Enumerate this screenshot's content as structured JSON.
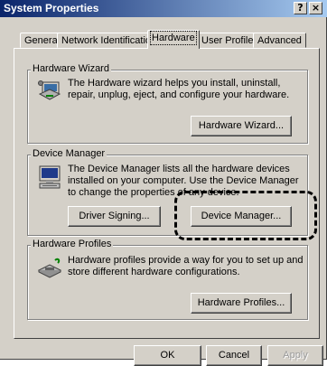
{
  "window": {
    "title": "System Properties"
  },
  "titlebar_buttons": {
    "help": "?",
    "close": "×"
  },
  "tabs": [
    {
      "label": "General"
    },
    {
      "label": "Network Identification"
    },
    {
      "label": "Hardware"
    },
    {
      "label": "User Profiles"
    },
    {
      "label": "Advanced"
    }
  ],
  "hardware_wizard": {
    "title": "Hardware Wizard",
    "description": "The Hardware wizard helps you install, uninstall, repair, unplug, eject, and configure your hardware.",
    "button": "Hardware Wizard..."
  },
  "device_manager": {
    "title": "Device Manager",
    "description": "The Device Manager lists all the hardware devices installed on your computer. Use the Device Manager to change the properties of any device.",
    "driver_signing_button": "Driver Signing...",
    "device_manager_button": "Device Manager..."
  },
  "hardware_profiles": {
    "title": "Hardware Profiles",
    "description": "Hardware profiles provide a way for you to set up and store different hardware configurations.",
    "button": "Hardware Profiles..."
  },
  "dialog_buttons": {
    "ok": "OK",
    "cancel": "Cancel",
    "apply": "Apply"
  }
}
